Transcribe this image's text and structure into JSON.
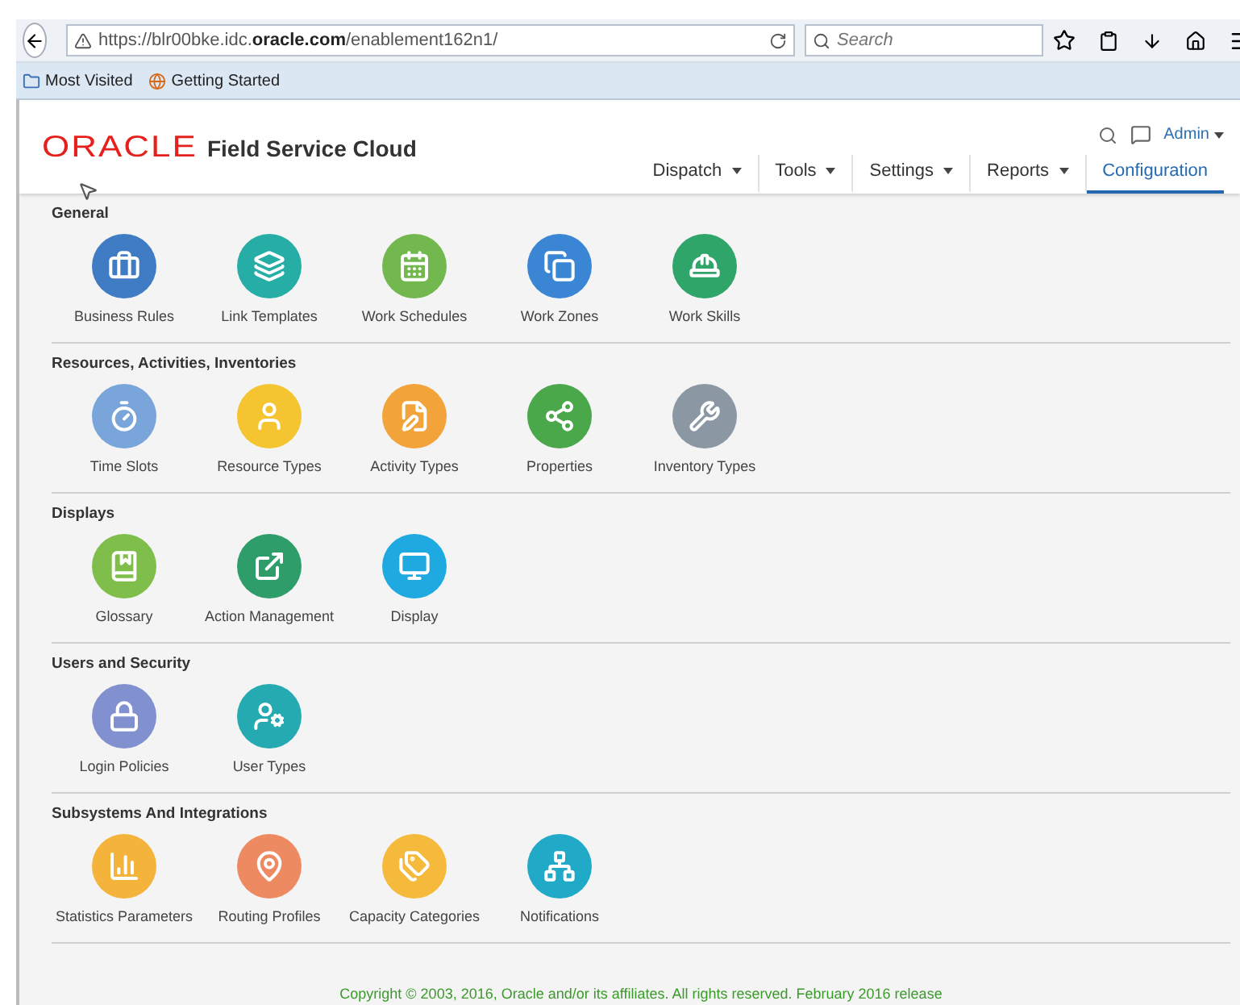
{
  "browser": {
    "url": "https://blr00bke.idc.**oracle.com**/enablement162n1/",
    "search": {
      "placeholder": "Search"
    },
    "bookmarks": [
      {
        "label": "Most Visited",
        "kind": "folder"
      },
      {
        "label": "Getting Started",
        "kind": "globe"
      }
    ]
  },
  "header": {
    "logo": "ORACLE",
    "product": "Field Service Cloud",
    "user": "Admin",
    "nav": [
      {
        "label": "Dispatch",
        "dropdown": true,
        "selected": false
      },
      {
        "label": "Tools",
        "dropdown": true,
        "selected": false
      },
      {
        "label": "Settings",
        "dropdown": true,
        "selected": false
      },
      {
        "label": "Reports",
        "dropdown": true,
        "selected": false
      },
      {
        "label": "Configuration",
        "dropdown": false,
        "selected": true
      }
    ]
  },
  "sections": [
    {
      "title": "General",
      "items": [
        {
          "label": "Business Rules",
          "kind": "briefcase",
          "color": "#3f7cc4"
        },
        {
          "label": "Link Templates",
          "kind": "link",
          "color": "#26ada6"
        },
        {
          "label": "Work Schedules",
          "kind": "calendar",
          "color": "#72b84f"
        },
        {
          "label": "Work Zones",
          "kind": "zones",
          "color": "#3a86d4"
        },
        {
          "label": "Work Skills",
          "kind": "skill",
          "color": "#2fa56a"
        }
      ]
    },
    {
      "title": "Resources, Activities, Inventories",
      "items": [
        {
          "label": "Time Slots",
          "kind": "timer",
          "color": "#7aa5db"
        },
        {
          "label": "Resource Types",
          "kind": "worker",
          "color": "#f5c531"
        },
        {
          "label": "Activity Types",
          "kind": "activity",
          "color": "#f2a33a"
        },
        {
          "label": "Properties",
          "kind": "properties",
          "color": "#4aa74a"
        },
        {
          "label": "Inventory Types",
          "kind": "tools",
          "color": "#8b97a3"
        }
      ]
    },
    {
      "title": "Displays",
      "items": [
        {
          "label": "Glossary",
          "kind": "book",
          "color": "#7fbe4a"
        },
        {
          "label": "Action Management",
          "kind": "external",
          "color": "#2f9d6a"
        },
        {
          "label": "Display",
          "kind": "monitor",
          "color": "#1ea9e1"
        }
      ]
    },
    {
      "title": "Users and Security",
      "items": [
        {
          "label": "Login Policies",
          "kind": "lock",
          "color": "#8191cf"
        },
        {
          "label": "User Types",
          "kind": "usergear",
          "color": "#24aab0"
        }
      ]
    },
    {
      "title": "Subsystems And Integrations",
      "items": [
        {
          "label": "Statistics Parameters",
          "kind": "chart",
          "color": "#f4b33b"
        },
        {
          "label": "Routing Profiles",
          "kind": "pin",
          "color": "#ee8a62"
        },
        {
          "label": "Capacity Categories",
          "kind": "tags",
          "color": "#f5b93b"
        },
        {
          "label": "Notifications",
          "kind": "share",
          "color": "#21a9c8"
        }
      ]
    }
  ],
  "footer": "Copyright © 2003, 2016, Oracle and/or its affiliates. All rights reserved. February 2016 release"
}
